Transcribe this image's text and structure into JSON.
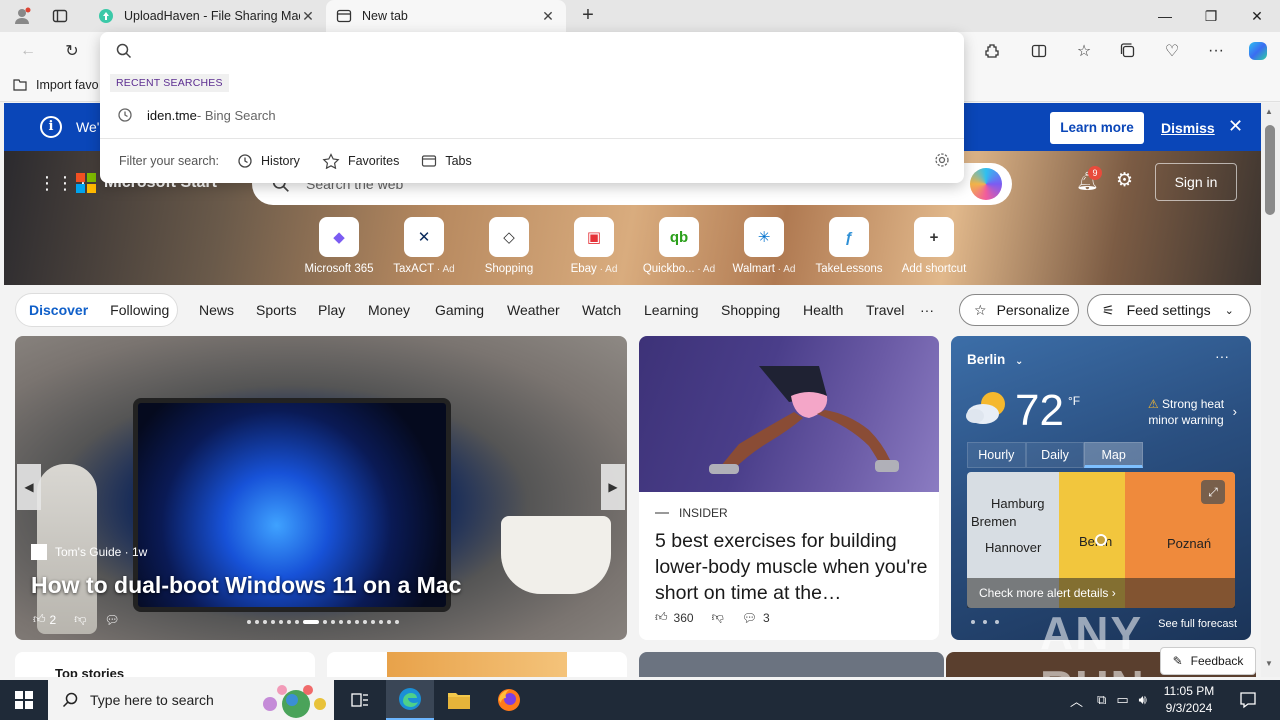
{
  "browser": {
    "tabs": [
      {
        "title": "UploadHaven - File Sharing Made Simple",
        "active": false
      },
      {
        "title": "New tab",
        "active": true
      }
    ],
    "favorites_bar": {
      "import_label": "Import favo"
    }
  },
  "omnibox": {
    "query": "",
    "recent_label": "RECENT SEARCHES",
    "recent": [
      {
        "query": "iden.tme",
        "source": " - Bing Search"
      }
    ],
    "filter_label": "Filter your search:",
    "filters": [
      "History",
      "Favorites",
      "Tabs"
    ]
  },
  "banner": {
    "message": "We'",
    "learn_more": "Learn more",
    "dismiss": "Dismiss"
  },
  "msn": {
    "brand": "Microsoft Start",
    "search_placeholder": "Search the web",
    "notification_count": "9",
    "sign_in": "Sign in",
    "shortcuts": [
      {
        "label": "Microsoft 365",
        "ad": "",
        "color": "#7b5cf2",
        "glyph": "◆"
      },
      {
        "label": "TaxACT",
        "ad": " · Ad",
        "color": "#0a2a5c",
        "glyph": "✕"
      },
      {
        "label": "Shopping",
        "ad": "",
        "color": "#333333",
        "glyph": "◇"
      },
      {
        "label": "Ebay",
        "ad": " · Ad",
        "color": "#e53238",
        "glyph": "▣"
      },
      {
        "label": "Quickbo...",
        "ad": " · Ad",
        "color": "#2ca01c",
        "glyph": "qb"
      },
      {
        "label": "Walmart",
        "ad": " · Ad",
        "color": "#0071ce",
        "glyph": "✳"
      },
      {
        "label": "TakeLessons",
        "ad": "",
        "color": "#2d8fd5",
        "glyph": "ƒ"
      },
      {
        "label": "Add shortcut",
        "ad": "",
        "color": "#333333",
        "glyph": "+"
      }
    ],
    "feed_tabs": {
      "discover": "Discover",
      "following": "Following"
    },
    "categories": [
      "News",
      "Sports",
      "Play",
      "Money",
      "Gaming",
      "Weather",
      "Watch",
      "Learning",
      "Shopping",
      "Health",
      "Travel",
      "···"
    ],
    "personalize": "Personalize",
    "feed_settings": "Feed settings"
  },
  "main_story": {
    "source": "Tom's Guide · 1w",
    "headline": "How to dual-boot Windows 11 on a Mac",
    "likes": "2"
  },
  "side_story": {
    "source": "INSIDER",
    "headline": "5 best exercises for building lower-body muscle when you're short on time at the…",
    "likes": "360",
    "comments": "3"
  },
  "weather": {
    "city": "Berlin",
    "temp": "72",
    "unit": "°F",
    "warning": "Strong heat minor warning",
    "tabs": [
      "Hourly",
      "Daily",
      "Map"
    ],
    "map_labels": [
      "Hamburg",
      "Bremen",
      "Hannover",
      "Berlin",
      "Poznań"
    ],
    "alert": "Check more alert details ›",
    "forecast": "See full forecast"
  },
  "bottom": {
    "top_stories": "Top stories"
  },
  "feedback": "Feedback",
  "watermark": "ANY RUN",
  "taskbar": {
    "search_placeholder": "Type here to search",
    "time": "11:05 PM",
    "date": "9/3/2024"
  }
}
